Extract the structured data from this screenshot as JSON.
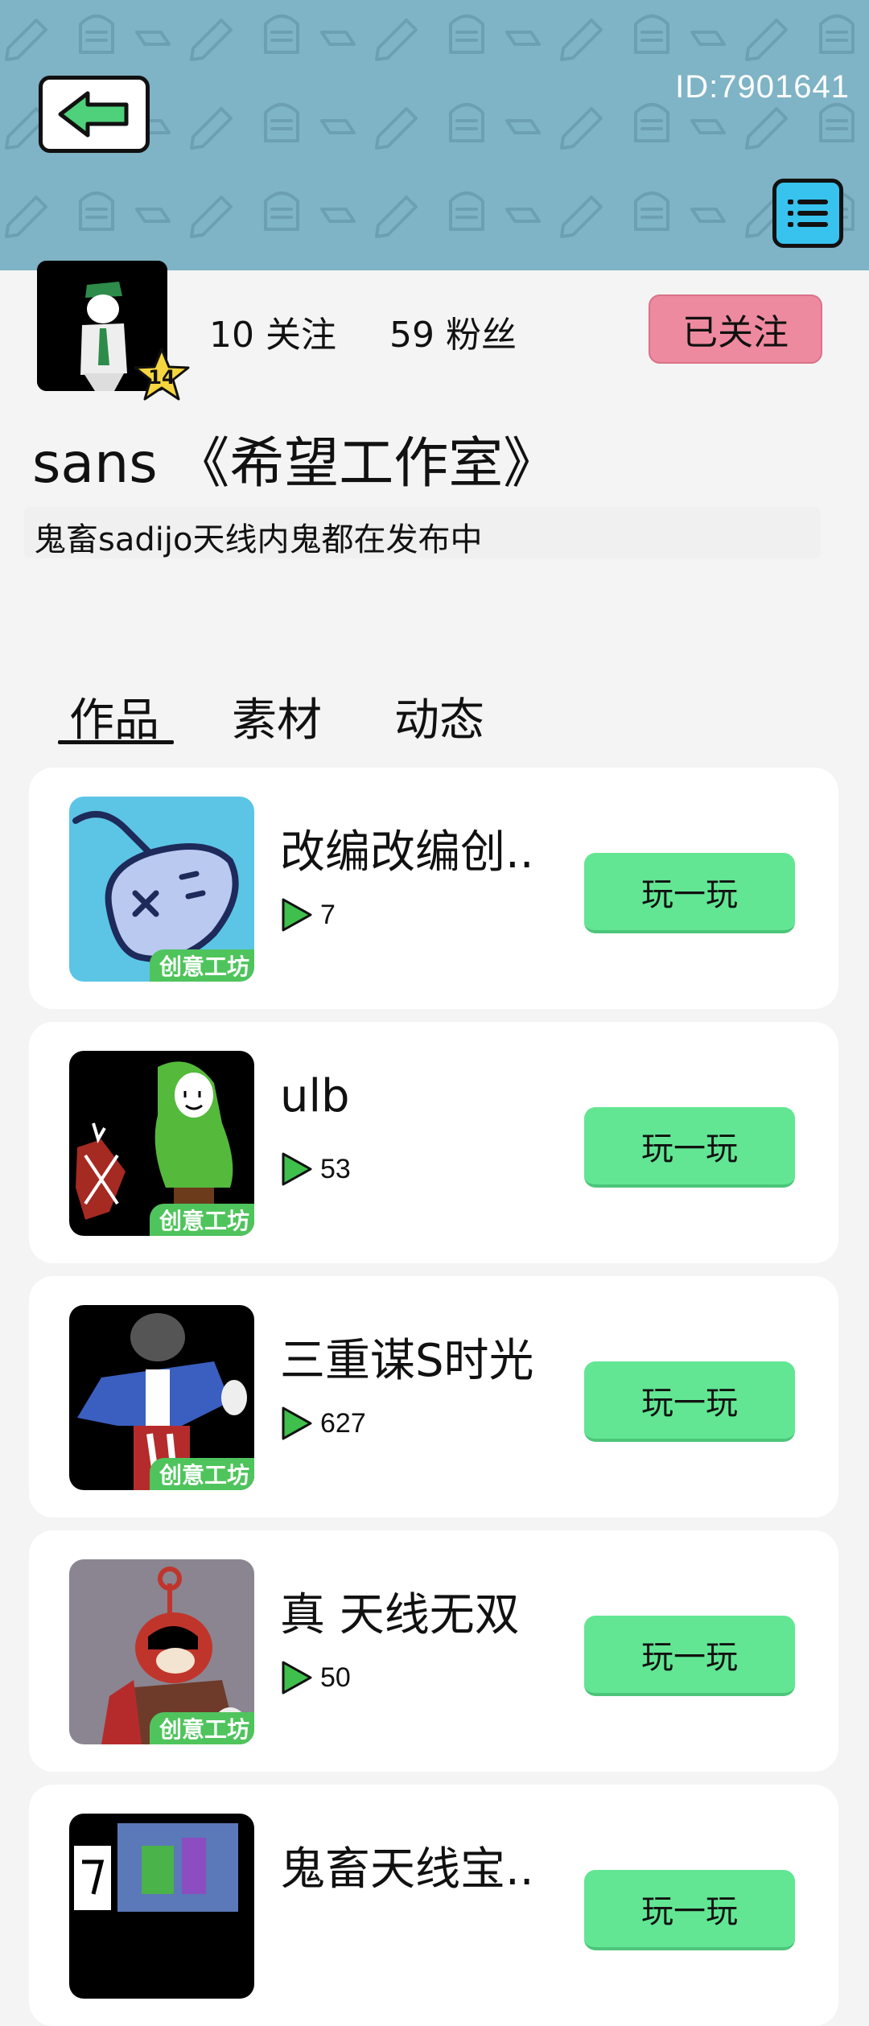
{
  "header": {
    "user_id": "ID:7901641"
  },
  "profile": {
    "following_label": "10 关注",
    "followers_label": "59 粉丝",
    "follow_button": "已关注",
    "level": "14",
    "username": "sans 《希望工作室》",
    "bio": "鬼畜sadijo天线内鬼都在发布中"
  },
  "tabs": [
    {
      "label": "作品",
      "active": true
    },
    {
      "label": "素材",
      "active": false
    },
    {
      "label": "动态",
      "active": false
    }
  ],
  "works": [
    {
      "title": "改编改编创..",
      "plays": "7",
      "tag": "创意工坊",
      "button": "玩一玩"
    },
    {
      "title": "ulb",
      "plays": "53",
      "tag": "创意工坊",
      "button": "玩一玩"
    },
    {
      "title": "三重谋S时光",
      "plays": "627",
      "tag": "创意工坊",
      "button": "玩一玩"
    },
    {
      "title": "真 天线无双",
      "plays": "50",
      "tag": "创意工坊",
      "button": "玩一玩"
    },
    {
      "title": "鬼畜天线宝..",
      "plays": "",
      "tag": "",
      "button": "玩一玩"
    }
  ],
  "colors": {
    "header_bg": "#7fb3c6",
    "follow_button": "#ee8a9f",
    "play_button": "#62e693",
    "tag_bg": "#4fc45c",
    "menu_button": "#38c3ef",
    "back_arrow": "#4fd07a"
  },
  "icons": {
    "back": "arrow-left-icon",
    "menu": "list-menu-icon",
    "play": "play-triangle-icon",
    "level": "star-icon"
  }
}
